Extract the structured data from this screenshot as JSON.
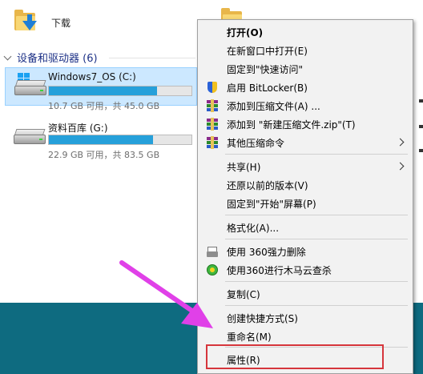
{
  "explorer": {
    "downloads_label": "下载",
    "section_header": "设备和驱动器 (6)",
    "drives": [
      {
        "name": "Windows7_OS (C:)",
        "free_text": "10.7 GB 可用，共 45.0 GB",
        "used_percent": 76,
        "selected": true
      },
      {
        "name": "资料百库 (G:)",
        "free_text": "22.9 GB 可用，共 83.5 GB",
        "used_percent": 73,
        "selected": false
      }
    ]
  },
  "context_menu": {
    "items": [
      {
        "label": "打开(O)",
        "bold": true
      },
      {
        "label": "在新窗口中打开(E)"
      },
      {
        "label": "固定到\"快速访问\""
      },
      {
        "label": "启用 BitLocker(B)",
        "icon": "bitlocker-shield-icon"
      },
      {
        "label": "添加到压缩文件(A) ...",
        "icon": "winrar-archive-icon"
      },
      {
        "label": "添加到 \"新建压缩文件.zip\"(T)",
        "icon": "winrar-archive-icon"
      },
      {
        "label": "其他压缩命令",
        "icon": "winrar-archive-icon",
        "submenu": true
      },
      {
        "label": "共享(H)",
        "submenu": true
      },
      {
        "label": "还原以前的版本(V)"
      },
      {
        "label": "固定到\"开始\"屏幕(P)"
      },
      {
        "label": "格式化(A)..."
      },
      {
        "label": "使用 360强力删除",
        "icon": "shredder-icon"
      },
      {
        "label": "使用360进行木马云查杀",
        "icon": "360-scan-icon"
      },
      {
        "label": "复制(C)"
      },
      {
        "label": "创建快捷方式(S)"
      },
      {
        "label": "重命名(M)"
      },
      {
        "label": "属性(R)"
      }
    ]
  },
  "annotation": {
    "arrow_color": "#e040e8",
    "box_color": "#d6363c"
  }
}
